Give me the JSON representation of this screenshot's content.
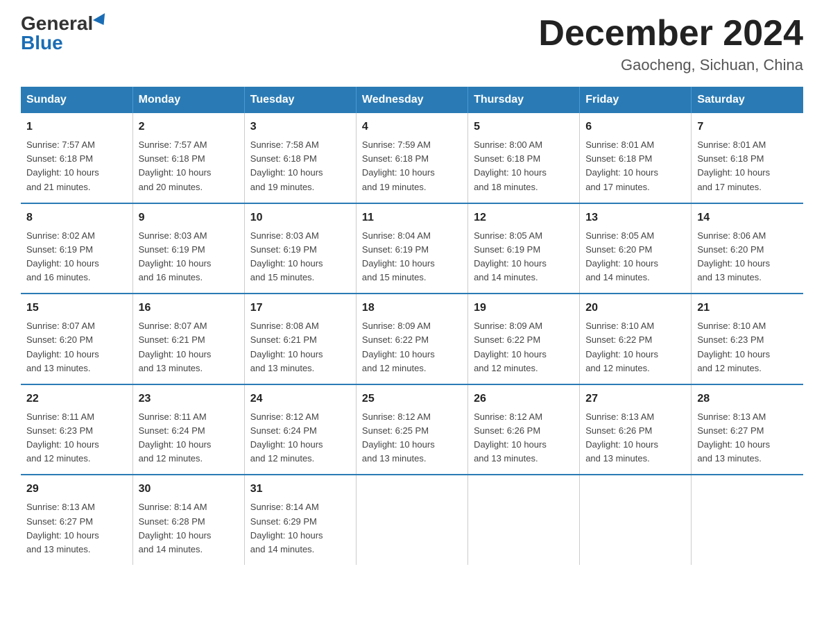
{
  "logo": {
    "general": "General",
    "blue": "Blue"
  },
  "title": {
    "month_year": "December 2024",
    "location": "Gaocheng, Sichuan, China"
  },
  "headers": [
    "Sunday",
    "Monday",
    "Tuesday",
    "Wednesday",
    "Thursday",
    "Friday",
    "Saturday"
  ],
  "weeks": [
    [
      {
        "day": "1",
        "info": "Sunrise: 7:57 AM\nSunset: 6:18 PM\nDaylight: 10 hours\nand 21 minutes."
      },
      {
        "day": "2",
        "info": "Sunrise: 7:57 AM\nSunset: 6:18 PM\nDaylight: 10 hours\nand 20 minutes."
      },
      {
        "day": "3",
        "info": "Sunrise: 7:58 AM\nSunset: 6:18 PM\nDaylight: 10 hours\nand 19 minutes."
      },
      {
        "day": "4",
        "info": "Sunrise: 7:59 AM\nSunset: 6:18 PM\nDaylight: 10 hours\nand 19 minutes."
      },
      {
        "day": "5",
        "info": "Sunrise: 8:00 AM\nSunset: 6:18 PM\nDaylight: 10 hours\nand 18 minutes."
      },
      {
        "day": "6",
        "info": "Sunrise: 8:01 AM\nSunset: 6:18 PM\nDaylight: 10 hours\nand 17 minutes."
      },
      {
        "day": "7",
        "info": "Sunrise: 8:01 AM\nSunset: 6:18 PM\nDaylight: 10 hours\nand 17 minutes."
      }
    ],
    [
      {
        "day": "8",
        "info": "Sunrise: 8:02 AM\nSunset: 6:19 PM\nDaylight: 10 hours\nand 16 minutes."
      },
      {
        "day": "9",
        "info": "Sunrise: 8:03 AM\nSunset: 6:19 PM\nDaylight: 10 hours\nand 16 minutes."
      },
      {
        "day": "10",
        "info": "Sunrise: 8:03 AM\nSunset: 6:19 PM\nDaylight: 10 hours\nand 15 minutes."
      },
      {
        "day": "11",
        "info": "Sunrise: 8:04 AM\nSunset: 6:19 PM\nDaylight: 10 hours\nand 15 minutes."
      },
      {
        "day": "12",
        "info": "Sunrise: 8:05 AM\nSunset: 6:19 PM\nDaylight: 10 hours\nand 14 minutes."
      },
      {
        "day": "13",
        "info": "Sunrise: 8:05 AM\nSunset: 6:20 PM\nDaylight: 10 hours\nand 14 minutes."
      },
      {
        "day": "14",
        "info": "Sunrise: 8:06 AM\nSunset: 6:20 PM\nDaylight: 10 hours\nand 13 minutes."
      }
    ],
    [
      {
        "day": "15",
        "info": "Sunrise: 8:07 AM\nSunset: 6:20 PM\nDaylight: 10 hours\nand 13 minutes."
      },
      {
        "day": "16",
        "info": "Sunrise: 8:07 AM\nSunset: 6:21 PM\nDaylight: 10 hours\nand 13 minutes."
      },
      {
        "day": "17",
        "info": "Sunrise: 8:08 AM\nSunset: 6:21 PM\nDaylight: 10 hours\nand 13 minutes."
      },
      {
        "day": "18",
        "info": "Sunrise: 8:09 AM\nSunset: 6:22 PM\nDaylight: 10 hours\nand 12 minutes."
      },
      {
        "day": "19",
        "info": "Sunrise: 8:09 AM\nSunset: 6:22 PM\nDaylight: 10 hours\nand 12 minutes."
      },
      {
        "day": "20",
        "info": "Sunrise: 8:10 AM\nSunset: 6:22 PM\nDaylight: 10 hours\nand 12 minutes."
      },
      {
        "day": "21",
        "info": "Sunrise: 8:10 AM\nSunset: 6:23 PM\nDaylight: 10 hours\nand 12 minutes."
      }
    ],
    [
      {
        "day": "22",
        "info": "Sunrise: 8:11 AM\nSunset: 6:23 PM\nDaylight: 10 hours\nand 12 minutes."
      },
      {
        "day": "23",
        "info": "Sunrise: 8:11 AM\nSunset: 6:24 PM\nDaylight: 10 hours\nand 12 minutes."
      },
      {
        "day": "24",
        "info": "Sunrise: 8:12 AM\nSunset: 6:24 PM\nDaylight: 10 hours\nand 12 minutes."
      },
      {
        "day": "25",
        "info": "Sunrise: 8:12 AM\nSunset: 6:25 PM\nDaylight: 10 hours\nand 13 minutes."
      },
      {
        "day": "26",
        "info": "Sunrise: 8:12 AM\nSunset: 6:26 PM\nDaylight: 10 hours\nand 13 minutes."
      },
      {
        "day": "27",
        "info": "Sunrise: 8:13 AM\nSunset: 6:26 PM\nDaylight: 10 hours\nand 13 minutes."
      },
      {
        "day": "28",
        "info": "Sunrise: 8:13 AM\nSunset: 6:27 PM\nDaylight: 10 hours\nand 13 minutes."
      }
    ],
    [
      {
        "day": "29",
        "info": "Sunrise: 8:13 AM\nSunset: 6:27 PM\nDaylight: 10 hours\nand 13 minutes."
      },
      {
        "day": "30",
        "info": "Sunrise: 8:14 AM\nSunset: 6:28 PM\nDaylight: 10 hours\nand 14 minutes."
      },
      {
        "day": "31",
        "info": "Sunrise: 8:14 AM\nSunset: 6:29 PM\nDaylight: 10 hours\nand 14 minutes."
      },
      {
        "day": "",
        "info": ""
      },
      {
        "day": "",
        "info": ""
      },
      {
        "day": "",
        "info": ""
      },
      {
        "day": "",
        "info": ""
      }
    ]
  ]
}
